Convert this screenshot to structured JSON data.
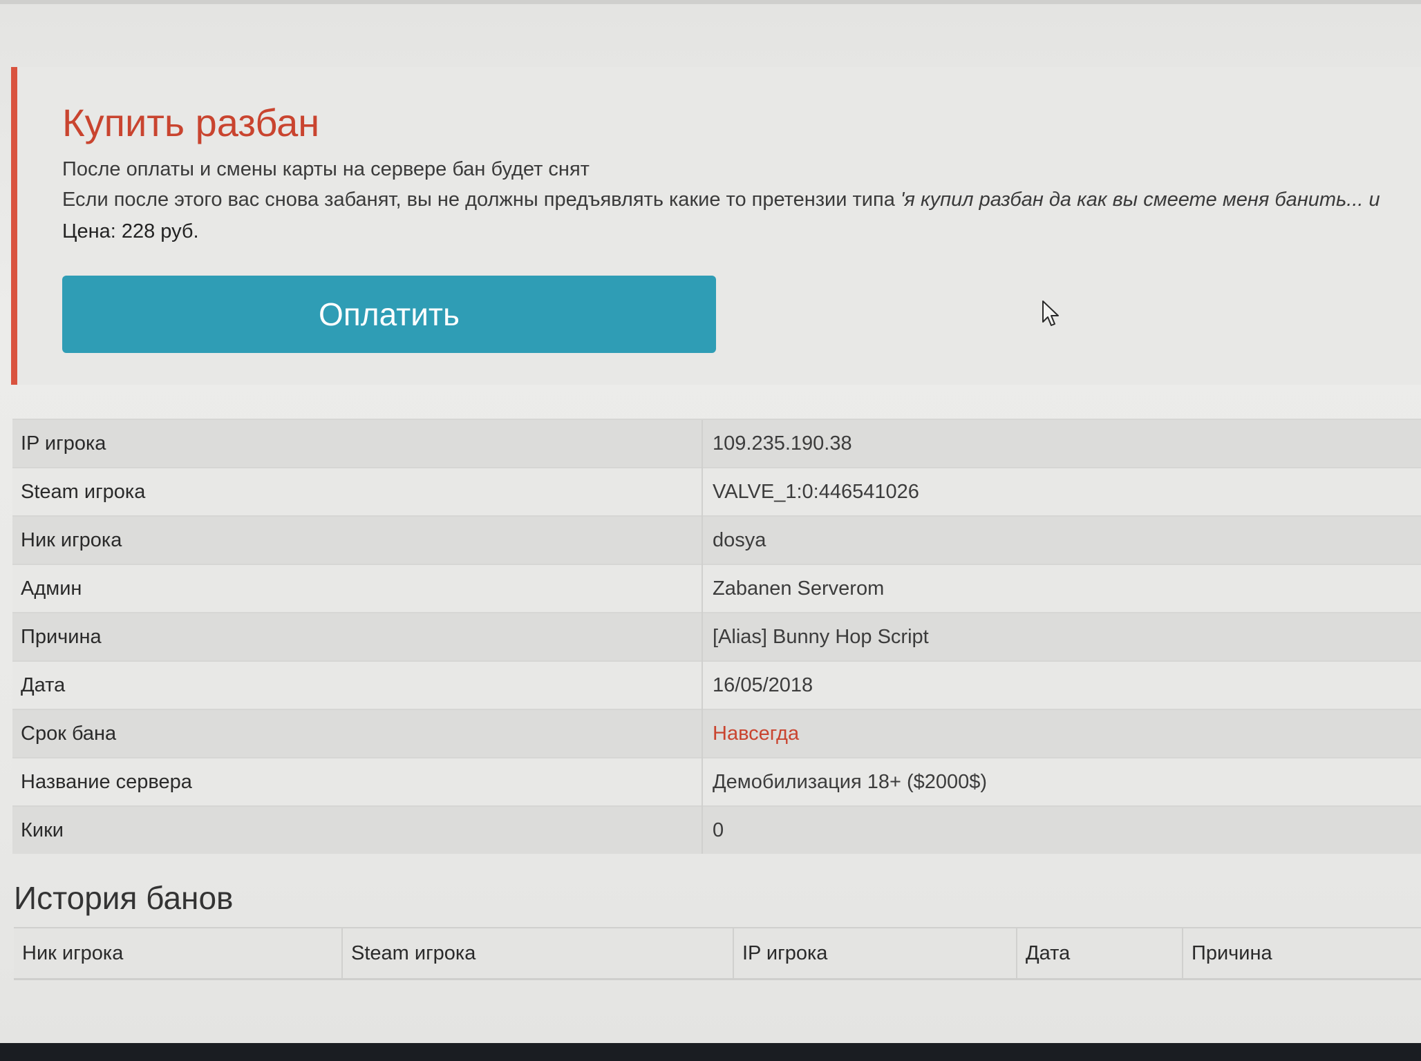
{
  "callout": {
    "title": "Купить разбан",
    "line1": "После оплаты и смены карты на сервере бан будет снят",
    "line2_prefix": "Если после этого вас снова забанят, вы не должны предъявлять какие то претензии типа ",
    "line2_quote": "'я купил разбан да как вы смеете меня банить... и",
    "price": "Цена: 228 руб.",
    "pay_button_label": "Оплатить",
    "accent_color": "#d9533f",
    "button_color": "#2f9db5"
  },
  "ban_info": {
    "rows": [
      {
        "key": "IP игрока",
        "value": "109.235.190.38"
      },
      {
        "key": "Steam игрока",
        "value": "VALVE_1:0:446541026"
      },
      {
        "key": "Ник игрока",
        "value": "dosya"
      },
      {
        "key": "Админ",
        "value": "Zabanen Serverom"
      },
      {
        "key": "Причина",
        "value": "[Alias] Bunny Hop Script"
      },
      {
        "key": "Дата",
        "value": "16/05/2018"
      },
      {
        "key": "Срок бана",
        "value": "Навсегда"
      },
      {
        "key": "Название сервера",
        "value": "Демобилизация 18+ ($2000$)"
      },
      {
        "key": "Кики",
        "value": "0"
      }
    ],
    "highlight_color": "#c9442f"
  },
  "history": {
    "title": "История банов",
    "columns": [
      "Ник игрока",
      "Steam игрока",
      "IP игрока",
      "Дата",
      "Причина"
    ]
  },
  "cursor": {
    "icon": "mouse-pointer-icon"
  }
}
